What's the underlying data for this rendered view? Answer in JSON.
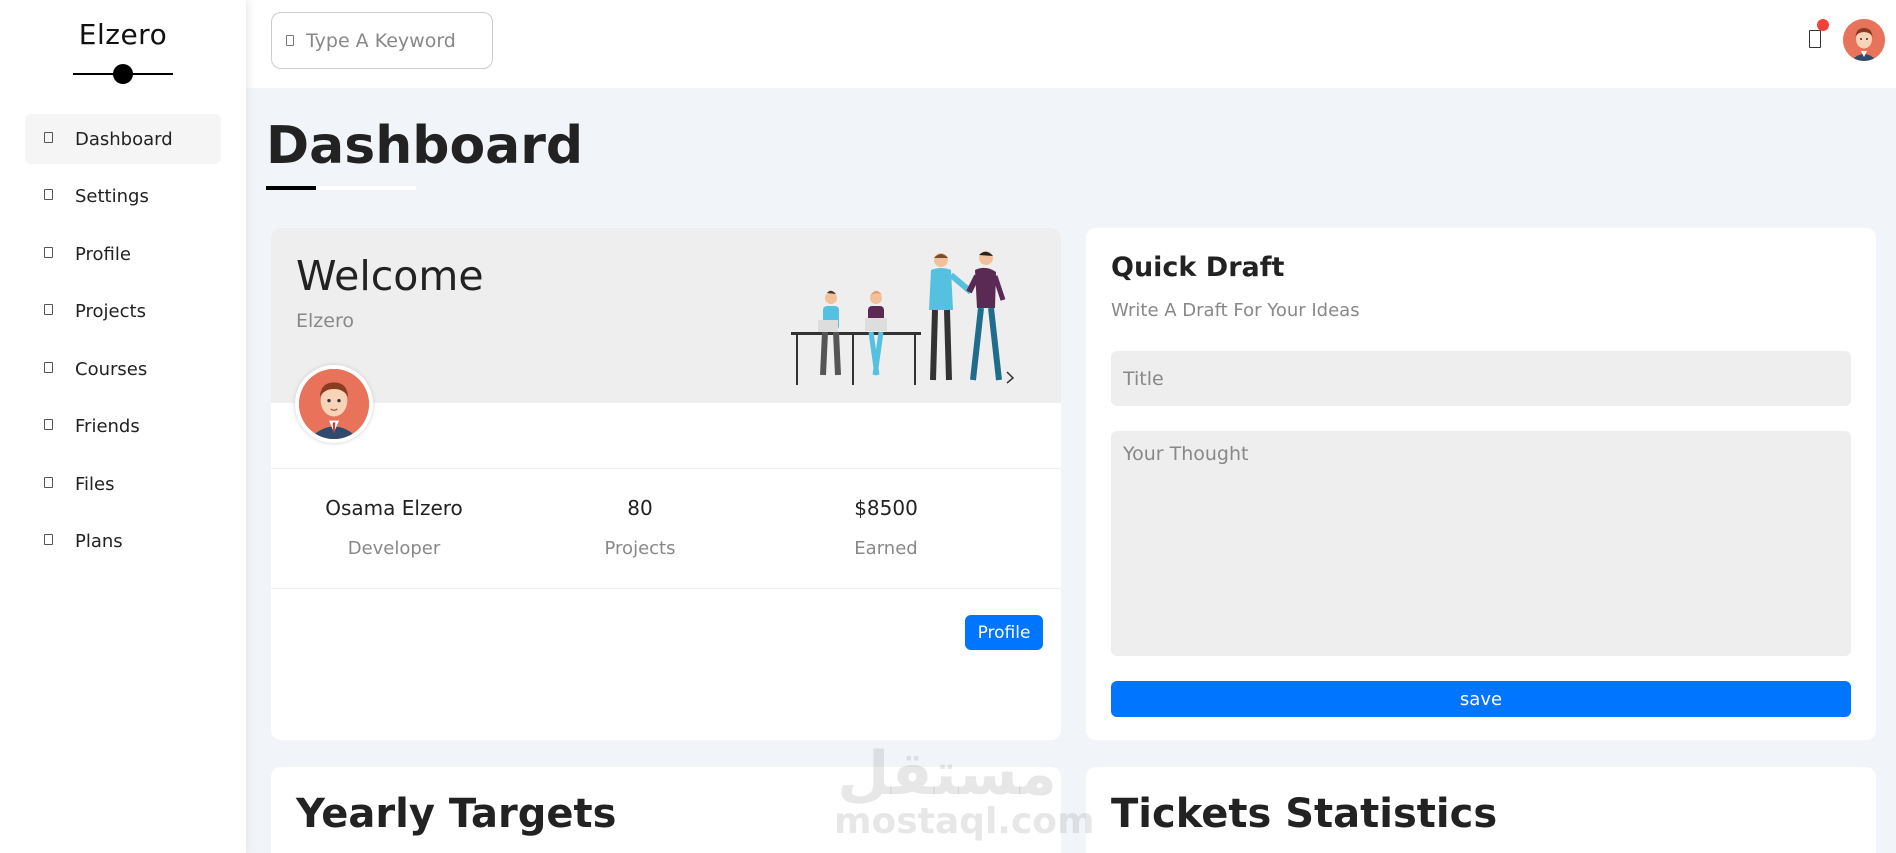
{
  "sidebar": {
    "brand": "Elzero",
    "items": [
      {
        "label": "Dashboard",
        "icon": "dashboard-icon",
        "active": true
      },
      {
        "label": "Settings",
        "icon": "settings-icon"
      },
      {
        "label": "Profile",
        "icon": "profile-icon"
      },
      {
        "label": "Projects",
        "icon": "projects-icon"
      },
      {
        "label": "Courses",
        "icon": "courses-icon"
      },
      {
        "label": "Friends",
        "icon": "friends-icon"
      },
      {
        "label": "Files",
        "icon": "files-icon"
      },
      {
        "label": "Plans",
        "icon": "plans-icon"
      }
    ]
  },
  "header": {
    "search_placeholder": "Type A Keyword",
    "notification_icon": "bell-icon",
    "notification_badge_color": "#f44336"
  },
  "page": {
    "title": "Dashboard"
  },
  "welcome": {
    "title": "Welcome",
    "subtitle": "Elzero",
    "stats": [
      {
        "value": "Osama Elzero",
        "label": "Developer"
      },
      {
        "value": "80",
        "label": "Projects"
      },
      {
        "value": "$8500",
        "label": "Earned"
      }
    ],
    "profile_button": "Profile"
  },
  "quick_draft": {
    "title": "Quick Draft",
    "subtitle": "Write A Draft For Your Ideas",
    "title_placeholder": "Title",
    "thought_placeholder": "Your Thought",
    "save_button": "save"
  },
  "yearly_targets": {
    "title": "Yearly Targets"
  },
  "tickets_statistics": {
    "title": "Tickets Statistics"
  },
  "watermark": {
    "arabic": "مستقل",
    "latin": "mostaql.com"
  },
  "colors": {
    "accent": "#0075ff",
    "background": "#f1f5f9",
    "avatar": "#e8735a"
  }
}
